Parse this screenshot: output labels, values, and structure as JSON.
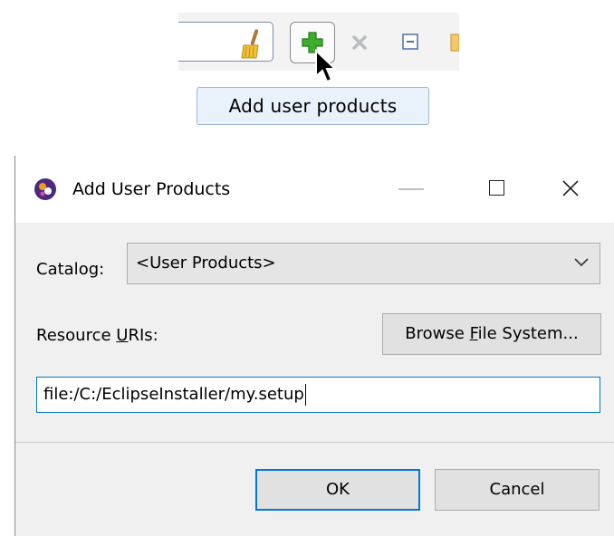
{
  "toolbar": {
    "tooltip": "Add user products",
    "icons": [
      "broom-icon",
      "add-icon",
      "remove-icon",
      "collapse-all-icon",
      "folder-icon"
    ]
  },
  "dialog": {
    "title": "Add User Products",
    "catalog_label": "Catalog:",
    "catalog_value": "<User Products>",
    "resource_label_pre": "Resource ",
    "resource_label_mnemonic": "U",
    "resource_label_post": "RIs:",
    "browse_pre": "Browse ",
    "browse_mnemonic": "F",
    "browse_post": "ile System...",
    "uri_value": "file:/C:/EclipseInstaller/my.setup",
    "ok_label": "OK",
    "cancel_label": "Cancel"
  },
  "colors": {
    "accent": "#0078d7",
    "tooltip_bg": "#e9f1fb",
    "add_icon_green": "#3cae2c"
  }
}
